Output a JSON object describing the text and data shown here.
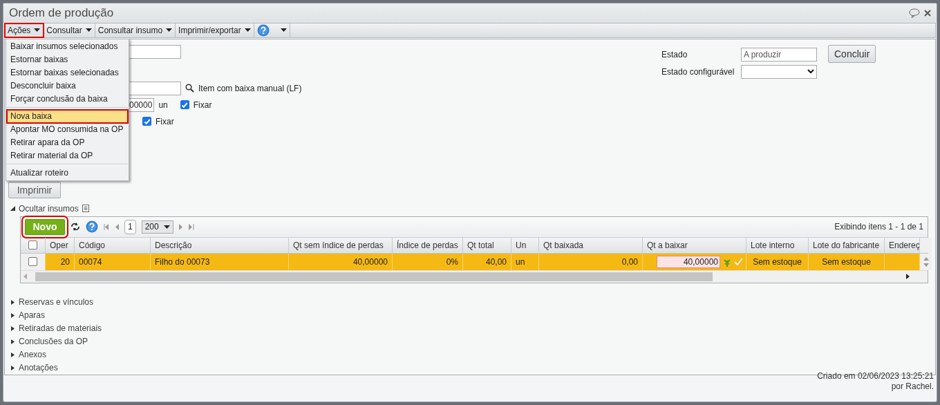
{
  "window": {
    "title": "Ordem de produção"
  },
  "toolbar": [
    {
      "kind": "menu",
      "label": "Ações",
      "selected": true,
      "highlighted": true
    },
    {
      "kind": "menu",
      "label": "Consultar",
      "selected": false,
      "highlighted": false
    },
    {
      "kind": "menu",
      "label": "Consultar insumo",
      "selected": false,
      "highlighted": false
    },
    {
      "kind": "menu",
      "label": "Imprimir/exportar",
      "selected": false,
      "highlighted": false
    },
    {
      "kind": "help",
      "selected": false,
      "highlighted": false
    }
  ],
  "actions_menu": {
    "groups": [
      [
        {
          "label": "Baixar insumos selecionados",
          "selected": false,
          "highlighted": false
        },
        {
          "label": "Estornar baixas",
          "selected": false,
          "highlighted": false
        },
        {
          "label": "Estornar baixas selecionadas",
          "selected": false,
          "highlighted": false
        },
        {
          "label": "Desconcluir baixa",
          "selected": false,
          "highlighted": false
        },
        {
          "label": "Forçar conclusão da baixa",
          "selected": false,
          "highlighted": false
        }
      ],
      [
        {
          "label": "Nova baixa",
          "selected": true,
          "highlighted": true
        },
        {
          "label": "Apontar MO consumida na OP",
          "selected": false,
          "highlighted": false
        },
        {
          "label": "Retirar apara da OP",
          "selected": false,
          "highlighted": false
        },
        {
          "label": "Retirar material da OP",
          "selected": false,
          "highlighted": false
        }
      ],
      [
        {
          "label": "Atualizar roteiro",
          "selected": false,
          "highlighted": false
        }
      ]
    ]
  },
  "form": {
    "lookup_label": "Item com baixa manual (LF)",
    "quantity": {
      "value": "00000",
      "unit": "un",
      "fix_label": "Fixar",
      "fix_checked": true
    },
    "fix_2": {
      "label": "Fixar",
      "checked": true
    },
    "print_button": "Imprimir",
    "estado": {
      "label": "Estado",
      "value": "A produzir"
    },
    "estado_configuravel": {
      "label": "Estado configurável"
    },
    "conclude_button": "Concluir"
  },
  "inputs_section": {
    "toggle": "Ocultar insumos",
    "expanded": true,
    "new_button": {
      "label": "Novo",
      "highlighted": true
    },
    "page": "1",
    "page_size": "200",
    "summary": "Exibindo itens 1 - 1 de 1",
    "columns": [
      "Oper",
      "Código",
      "Descrição",
      "Qt sem índice de perdas",
      "Índice de perdas",
      "Qt total",
      "Un",
      "Qt baixada",
      "Qt a baixar",
      "Lote interno",
      "Lote do fabricante",
      "Endereç"
    ],
    "header_checked": false,
    "rows": [
      {
        "selected": true,
        "checked": false,
        "cells": [
          "20",
          "00074",
          "Filho do 00073",
          "40,00000",
          "0%",
          "40,00",
          "un",
          "0,00",
          "40,00000",
          "Sem estoque",
          "Sem estoque"
        ]
      }
    ]
  },
  "sections": [
    {
      "label": "Reservas e vínculos",
      "expanded": false
    },
    {
      "label": "Aparas",
      "expanded": false
    },
    {
      "label": "Retiradas de materiais",
      "expanded": false
    },
    {
      "label": "Conclusões da OP",
      "expanded": false
    },
    {
      "label": "Anexos",
      "expanded": false
    },
    {
      "label": "Anotações",
      "expanded": false
    }
  ],
  "footer": [
    "Criado em 02/06/2023 13:25:21",
    "por Rachel."
  ]
}
